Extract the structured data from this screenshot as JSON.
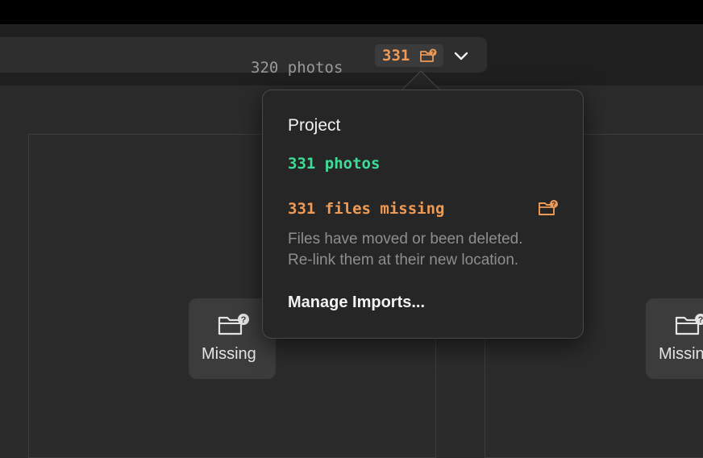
{
  "toolbar": {
    "photo_count": "320 photos",
    "missing_badge": "331",
    "missing_icon": "folder-question-icon",
    "dropdown_icon": "chevron-down-icon"
  },
  "tiles": [
    {
      "label": "Missing",
      "icon": "folder-question-icon"
    },
    {
      "label": "Missin",
      "icon": "folder-question-icon"
    }
  ],
  "popover": {
    "title": "Project",
    "photos": "331 photos",
    "missing": "331 files missing",
    "missing_icon": "folder-question-icon",
    "description_line1": "Files have moved or been deleted.",
    "description_line2": "Re-link them at their new location.",
    "action": "Manage Imports..."
  },
  "colors": {
    "accent_orange": "#ef9a55",
    "accent_green": "#3ddc97",
    "background": "#2b2b2b"
  }
}
